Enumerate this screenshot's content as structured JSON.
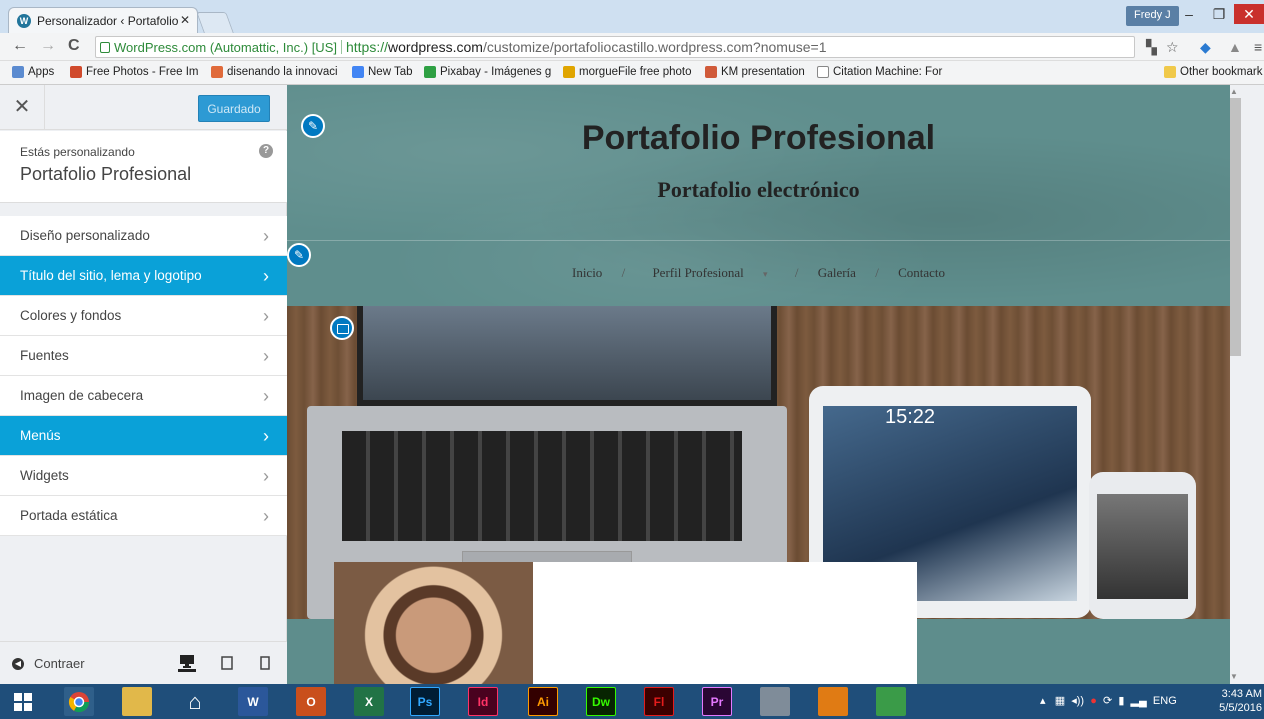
{
  "browser": {
    "tab_title": "Personalizador ‹ Portafolio",
    "user": "Fredy J",
    "secure_label": "WordPress.com (Automattic, Inc.) [US]",
    "url_proto": "https://",
    "url_host": "wordpress.com",
    "url_path": "/customize/portafoliocastillo.wordpress.com?nomuse=1",
    "bookmarks": [
      {
        "label": "Apps",
        "color": "#5b8bd0"
      },
      {
        "label": "Free Photos - Free Im",
        "color": "#d04a2c"
      },
      {
        "label": "disenando la innovaci",
        "color": "#e06a3a"
      },
      {
        "label": "New Tab",
        "color": "#4285f4"
      },
      {
        "label": "Pixabay - Imágenes g",
        "color": "#2ea043"
      },
      {
        "label": "morgueFile free photo",
        "color": "#e0a500"
      },
      {
        "label": "KM presentation",
        "color": "#d05a3a"
      },
      {
        "label": "Citation Machine: For",
        "color": "#888888"
      }
    ],
    "other_bookmarks": "Other bookmark"
  },
  "panel": {
    "saved_label": "Guardado",
    "caption": "Estás personalizando",
    "site_name": "Portafolio Profesional",
    "sections": [
      {
        "label": "Diseño personalizado",
        "active": false
      },
      {
        "label": "Título del sitio, lema y logotipo",
        "active": true
      },
      {
        "label": "Colores y fondos",
        "active": false
      },
      {
        "label": "Fuentes",
        "active": false
      },
      {
        "label": "Imagen de cabecera",
        "active": false
      },
      {
        "label": "Menús",
        "active": true
      },
      {
        "label": "Widgets",
        "active": false
      },
      {
        "label": "Portada estática",
        "active": false
      }
    ],
    "collapse_label": "Contraer"
  },
  "preview": {
    "site_title": "Portafolio Profesional",
    "tagline": "Portafolio electrónico",
    "nav": [
      "Inicio",
      "Perfil Profesional",
      "Galería",
      "Contacto"
    ],
    "tablet_time": "15:22"
  },
  "taskbar": {
    "apps": [
      {
        "name": "start-icon",
        "text": "",
        "bg": "#1f4e7a"
      },
      {
        "name": "chrome-icon",
        "text": "",
        "bg": "#2f5f8a"
      },
      {
        "name": "file-explorer-icon",
        "text": "",
        "bg": "#e1b84a"
      },
      {
        "name": "home-icon",
        "text": "",
        "bg": "#1f4e7a"
      },
      {
        "name": "word-icon",
        "text": "W",
        "bg": "#2b579a"
      },
      {
        "name": "outlook-icon",
        "text": "O",
        "bg": "#c94f1c"
      },
      {
        "name": "excel-icon",
        "text": "X",
        "bg": "#217346"
      },
      {
        "name": "photoshop-icon",
        "text": "Ps",
        "bg": "#001d34"
      },
      {
        "name": "indesign-icon",
        "text": "Id",
        "bg": "#49021f"
      },
      {
        "name": "illustrator-icon",
        "text": "Ai",
        "bg": "#330000"
      },
      {
        "name": "dreamweaver-icon",
        "text": "Dw",
        "bg": "#072401"
      },
      {
        "name": "flash-icon",
        "text": "Fl",
        "bg": "#3b0000"
      },
      {
        "name": "premiere-icon",
        "text": "Pr",
        "bg": "#2a0634"
      },
      {
        "name": "calculator-icon",
        "text": "",
        "bg": "#7f8c99"
      },
      {
        "name": "media-icon",
        "text": "",
        "bg": "#e07b14"
      },
      {
        "name": "photos-icon",
        "text": "",
        "bg": "#3a9b48"
      }
    ],
    "lang": "ENG",
    "time": "3:43 AM",
    "date": "5/5/2016"
  }
}
